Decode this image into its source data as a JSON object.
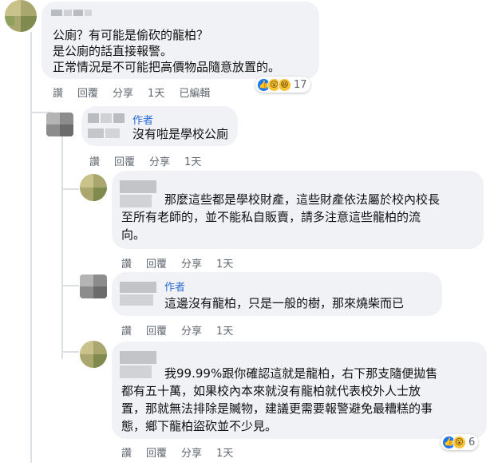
{
  "comments": [
    {
      "id": "c1",
      "text_lines": [
        "公廁？有可能是偷砍的龍柏？",
        "是公廁的話直接報警。",
        "正常情況是不可能把高價物品隨意放置的。"
      ],
      "actions": [
        "讚",
        "回覆",
        "分享",
        "1天",
        "已編輯"
      ],
      "reaction_icons": [
        "like-icon",
        "wow-icon",
        "haha-icon"
      ],
      "reaction_count": "17"
    },
    {
      "id": "c2",
      "badge": "作者",
      "text_lines": [
        "沒有啦是學校公廁"
      ],
      "actions": [
        "讚",
        "回覆",
        "分享",
        "1天"
      ]
    },
    {
      "id": "c3",
      "text_lines": [
        "那麼這些都是學校財產，這些財產依法屬於校內校長",
        "至所有老師的，並不能私自販賣，請多注意這些龍柏的流",
        "向。"
      ],
      "actions": [
        "讚",
        "回覆",
        "分享",
        "1天"
      ]
    },
    {
      "id": "c4",
      "badge": "作者",
      "text_lines": [
        "這邊沒有龍柏，只是一般的樹，那來燒柴而已"
      ],
      "actions": [
        "讚",
        "回覆",
        "分享",
        "1天"
      ]
    },
    {
      "id": "c5",
      "text_lines": [
        "我99.99%跟你確認這就是龍柏，右下那支隨便拋售",
        "都有五十萬，如果校內本來就沒有龍柏就代表校外人士放",
        "置，那就無法排除是贓物，建議更需要報警避免最糟糕的事",
        "態，鄉下龍柏盜砍並不少見。"
      ],
      "actions": [
        "讚",
        "回覆",
        "分享",
        "1天"
      ],
      "reaction_icons": [
        "like-icon",
        "wow-icon"
      ],
      "reaction_count": "6"
    }
  ],
  "colors": {
    "bubble": "#f0f2f5",
    "author_badge": "#2d6ad6",
    "action_text": "#606770",
    "like": "#1877f2",
    "wow": "#f7c233"
  }
}
